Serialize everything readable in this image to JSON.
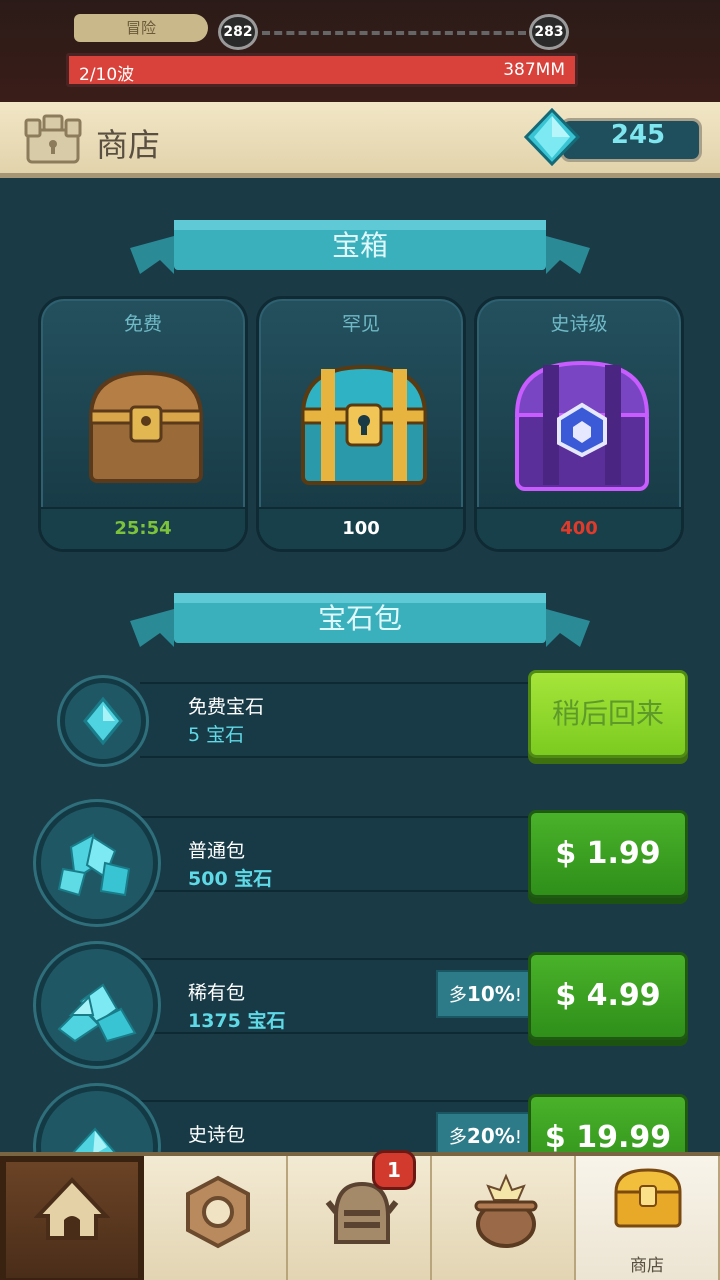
{
  "top": {
    "adventure_label": "冒险",
    "level_current": "282",
    "level_next": "283",
    "wave_text": "2/10波",
    "distance_text": "387MM"
  },
  "header": {
    "title": "商店",
    "gem_count": "245",
    "icon": "castle-shop-icon"
  },
  "chests_section": {
    "title": "宝箱",
    "chests": [
      {
        "title": "免费",
        "footer": "25:54",
        "footer_color": "#7cc23a",
        "icon": "wood-chest-icon"
      },
      {
        "title": "罕见",
        "footer": "100",
        "footer_color": "#ffffff",
        "icon": "rare-chest-icon"
      },
      {
        "title": "史诗级",
        "footer": "400",
        "footer_color": "#e23a2a",
        "icon": "epic-chest-icon"
      }
    ]
  },
  "gems_section": {
    "title": "宝石包",
    "packs": [
      {
        "name": "免费宝石",
        "amount": "5 宝石",
        "button": "稍后回来"
      },
      {
        "name": "普通包",
        "amount": "500 宝石",
        "button": "$ 1.99"
      },
      {
        "name": "稀有包",
        "amount": "1375 宝石",
        "button": "$ 4.99",
        "bonus_prefix": "多",
        "bonus_value": "10%",
        "bonus_suffix": "!"
      },
      {
        "name": "史诗包",
        "amount": "",
        "button": "$ 19.99",
        "bonus_prefix": "多",
        "bonus_value": "20%",
        "bonus_suffix": "!"
      }
    ]
  },
  "nav": {
    "tabs": [
      {
        "id": "home",
        "icon": "tent-icon"
      },
      {
        "id": "gear",
        "icon": "hex-nut-icon"
      },
      {
        "id": "heroes",
        "icon": "knight-helmet-icon",
        "badge": "1"
      },
      {
        "id": "cauldron",
        "icon": "cauldron-icon"
      },
      {
        "id": "shop",
        "icon": "chest-icon",
        "label": "商店"
      }
    ]
  },
  "colors": {
    "accent_gem": "#4fd3e0",
    "price_green": "#3aa322",
    "wave_red": "#d8423a"
  }
}
